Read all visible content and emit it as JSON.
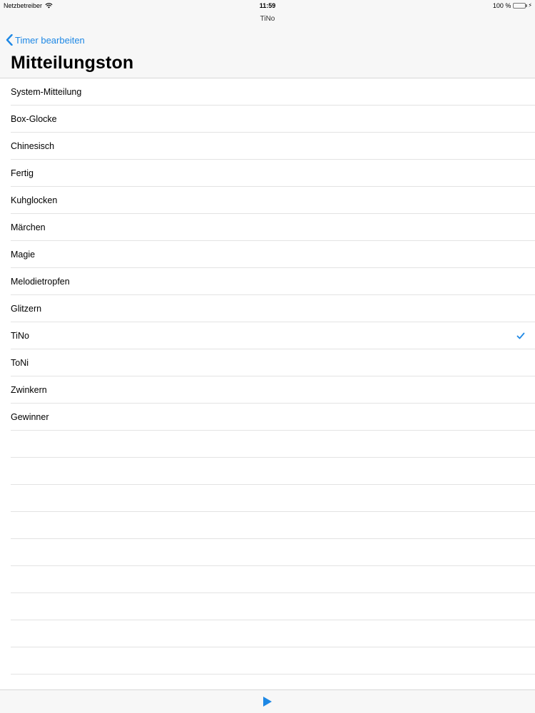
{
  "status_bar": {
    "carrier": "Netzbetreiber",
    "time": "11:59",
    "battery": "100 %",
    "battery_level": 1.0
  },
  "app_title": "TiNo",
  "nav": {
    "back_label": "Timer bearbeiten",
    "title": "Mitteilungston"
  },
  "sounds": [
    {
      "label": "System-Mitteilung",
      "selected": false
    },
    {
      "label": "Box-Glocke",
      "selected": false
    },
    {
      "label": "Chinesisch",
      "selected": false
    },
    {
      "label": "Fertig",
      "selected": false
    },
    {
      "label": "Kuhglocken",
      "selected": false
    },
    {
      "label": "Märchen",
      "selected": false
    },
    {
      "label": "Magie",
      "selected": false
    },
    {
      "label": "Melodietropfen",
      "selected": false
    },
    {
      "label": "Glitzern",
      "selected": false
    },
    {
      "label": "TiNo",
      "selected": true
    },
    {
      "label": "ToNi",
      "selected": false
    },
    {
      "label": "Zwinkern",
      "selected": false
    },
    {
      "label": "Gewinner",
      "selected": false
    }
  ],
  "toolbar": {
    "play_icon": "play-icon"
  },
  "colors": {
    "accent": "#1e88e5",
    "bar_background": "#f7f7f7",
    "separator": "#e3e3e3"
  }
}
